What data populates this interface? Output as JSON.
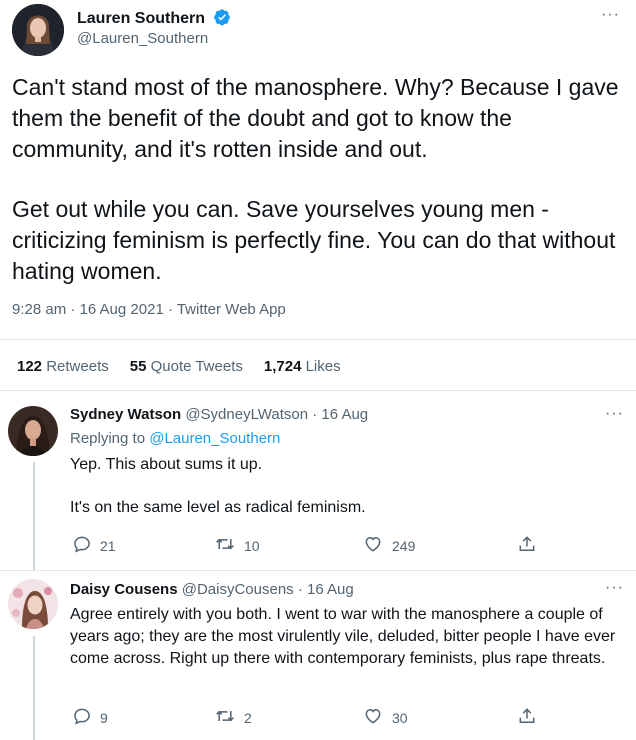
{
  "main_tweet": {
    "author_name": "Lauren Southern",
    "handle": "@Lauren_Southern",
    "paragraph1": "Can't stand most of the manosphere. Why? Because I gave them the benefit of the doubt and got to know the community, and it's rotten inside and out.",
    "paragraph2": "Get out while you can. Save yourselves young men - criticizing feminism is perfectly fine. You can do that without hating women.",
    "meta": "9:28 am · 16 Aug 2021 · Twitter Web App",
    "more": "···"
  },
  "stats": {
    "retweets_count": "122",
    "retweets_label": "Retweets",
    "quotes_count": "55",
    "quotes_label": "Quote Tweets",
    "likes_count": "1,724",
    "likes_label": "Likes"
  },
  "replies": [
    {
      "author_name": "Sydney Watson",
      "handle_date": "@SydneyLWatson · 16 Aug",
      "replying_prefix": "Replying to",
      "replying_to": "@Lauren_Southern",
      "line1": "Yep. This about sums it up.",
      "line2": "It's on the same level as radical feminism.",
      "reply_count": "21",
      "retweet_count": "10",
      "like_count": "249",
      "more": "···"
    },
    {
      "author_name": "Daisy Cousens",
      "handle_date": "@DaisyCousens · 16 Aug",
      "text": "Agree entirely with you both. I went to war with the manosphere a couple of years ago; they are the most virulently vile, deluded, bitter people I have ever come across. Right up there with contemporary feminists, plus rape threats.",
      "reply_count": "9",
      "retweet_count": "2",
      "like_count": "30",
      "more": "···"
    }
  ],
  "colors": {
    "accent": "#1d9bf0",
    "muted": "#536471",
    "divider": "#e4e8eb"
  }
}
